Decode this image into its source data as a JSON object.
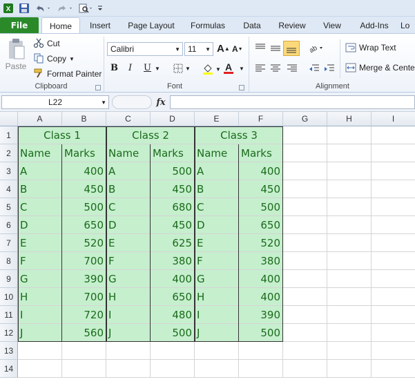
{
  "ribbon_tabs": {
    "file": "File",
    "home": "Home",
    "insert": "Insert",
    "page_layout": "Page Layout",
    "formulas": "Formulas",
    "data": "Data",
    "review": "Review",
    "view": "View",
    "addins": "Add-Ins",
    "extra": "Lo"
  },
  "clipboard": {
    "paste": "Paste",
    "cut": "Cut",
    "copy": "Copy",
    "format_painter": "Format Painter",
    "label": "Clipboard"
  },
  "font": {
    "name": "Calibri",
    "size": "11",
    "label": "Font",
    "bold": "B",
    "italic": "I",
    "underline": "U",
    "grow": "A",
    "shrink": "A",
    "font_color": "A"
  },
  "alignment": {
    "wrap_text": "Wrap Text",
    "merge_center": "Merge & Center",
    "label": "Alignment"
  },
  "formula_bar": {
    "name_box": "L22",
    "fx": "fx",
    "value": ""
  },
  "colors": {
    "cell_fill": "#c6efce",
    "cell_text": "#1a6b1a",
    "file_tab": "#2a8a2a"
  },
  "columns": [
    "A",
    "B",
    "C",
    "D",
    "E",
    "F",
    "G",
    "H",
    "I"
  ],
  "rows": [
    "1",
    "2",
    "3",
    "4",
    "5",
    "6",
    "7",
    "8",
    "9",
    "10",
    "11",
    "12",
    "13",
    "14"
  ],
  "sheet": {
    "headers": [
      "Class 1",
      "Class 2",
      "Class 3"
    ],
    "subheaders": [
      "Name",
      "Marks",
      "Name",
      "Marks",
      "Name",
      "Marks"
    ],
    "data": [
      [
        "A",
        "400",
        "A",
        "500",
        "A",
        "400"
      ],
      [
        "B",
        "450",
        "B",
        "450",
        "B",
        "450"
      ],
      [
        "C",
        "500",
        "C",
        "680",
        "C",
        "500"
      ],
      [
        "D",
        "650",
        "D",
        "450",
        "D",
        "650"
      ],
      [
        "E",
        "520",
        "E",
        "625",
        "E",
        "520"
      ],
      [
        "F",
        "700",
        "F",
        "380",
        "F",
        "380"
      ],
      [
        "G",
        "390",
        "G",
        "400",
        "G",
        "400"
      ],
      [
        "H",
        "700",
        "H",
        "650",
        "H",
        "400"
      ],
      [
        "I",
        "720",
        "I",
        "480",
        "I",
        "390"
      ],
      [
        "J",
        "560",
        "J",
        "500",
        "J",
        "500"
      ]
    ]
  }
}
